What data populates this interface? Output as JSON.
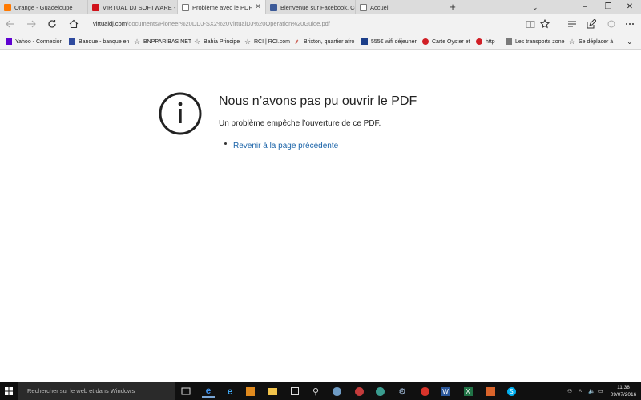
{
  "tabs": [
    {
      "label": "Orange - Guadeloupe",
      "favicon_color": "#ff7900"
    },
    {
      "label": "VIRTUAL DJ SOFTWARE - M",
      "favicon_color": "#d0121a"
    },
    {
      "label": "Problème avec le PDF",
      "favicon_color": "#ffffff",
      "active": true
    },
    {
      "label": "Bienvenue sur Facebook. Cc",
      "favicon_color": "#3b5998"
    },
    {
      "label": "Accueil",
      "favicon_color": "#ffffff"
    }
  ],
  "close_glyph": "×",
  "new_tab_glyph": "+",
  "address": {
    "domain": "virtualdj.com",
    "path": "/documents/Pioneer%20DDJ-SX2%20VirtualDJ%20Operation%20Guide.pdf"
  },
  "favorites": [
    {
      "label": "Yahoo - Connexion",
      "icon": "yahoo-icon",
      "color": "#5f01d1"
    },
    {
      "label": "Banque - banque en",
      "icon": "bank-icon",
      "color": "#2e4a9e"
    },
    {
      "label": "BNPPARIBAS NET",
      "icon": "star-icon",
      "color": "#555555"
    },
    {
      "label": "Bahia Principe",
      "icon": "star-icon",
      "color": "#555555"
    },
    {
      "label": "RCI | RCI.com",
      "icon": "star-icon",
      "color": "#555555"
    },
    {
      "label": "Brixton, quartier afro",
      "icon": "feather-icon",
      "color": "#c0392b"
    },
    {
      "label": "555€ wifi déjeuner",
      "icon": "b-icon",
      "color": "#1d3f8a"
    },
    {
      "label": "Carte Oyster et",
      "icon": "tfl-icon",
      "color": "#d11f26"
    },
    {
      "label": "http",
      "icon": "tfl-icon",
      "color": "#d11f26"
    },
    {
      "label": "Les transports zone",
      "icon": "transport-icon",
      "color": "#555555"
    },
    {
      "label": "Se déplacer à",
      "icon": "star-icon",
      "color": "#555555"
    }
  ],
  "main": {
    "title": "Nous n’avons pas pu ouvrir le PDF",
    "subtitle": "Un problème empêche l’ouverture de ce PDF.",
    "link": "Revenir à la page précédente"
  },
  "taskbar": {
    "search_placeholder": "Rechercher sur le web et dans Windows",
    "time": "11:38",
    "date": "09/07/2016"
  }
}
